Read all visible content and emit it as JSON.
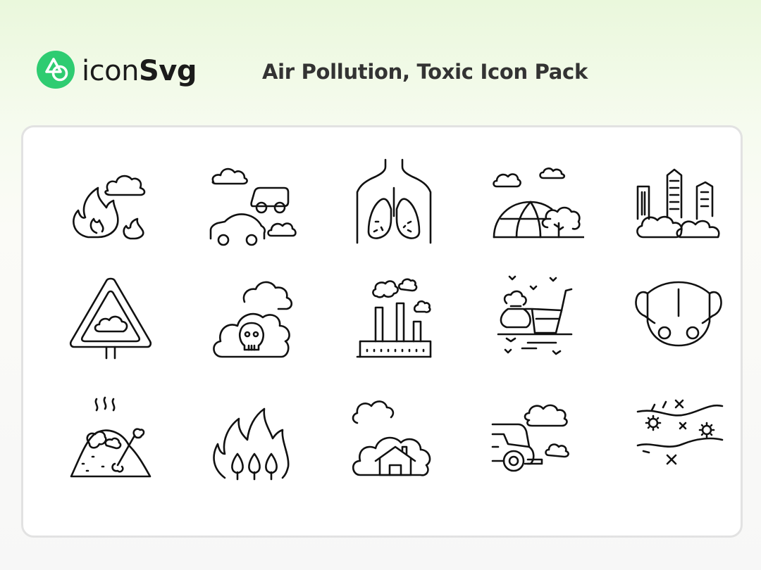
{
  "brand": {
    "name_regular": "icon",
    "name_bold": "Svg",
    "accent_color": "#2ecc71"
  },
  "title": "Air Pollution, Toxic Icon Pack",
  "icons": [
    {
      "name": "wildfire-smoke-icon"
    },
    {
      "name": "car-exhaust-clouds-icon"
    },
    {
      "name": "damaged-lungs-icon"
    },
    {
      "name": "globe-trees-clouds-icon"
    },
    {
      "name": "city-smog-icon"
    },
    {
      "name": "pollution-warning-sign-icon"
    },
    {
      "name": "toxic-cloud-skull-icon"
    },
    {
      "name": "factory-smoke-icon"
    },
    {
      "name": "litter-garbage-icon"
    },
    {
      "name": "face-mask-icon"
    },
    {
      "name": "landfill-waste-icon"
    },
    {
      "name": "forest-fire-icon"
    },
    {
      "name": "house-smog-icon"
    },
    {
      "name": "car-emission-icon"
    },
    {
      "name": "polluted-river-icon"
    }
  ]
}
